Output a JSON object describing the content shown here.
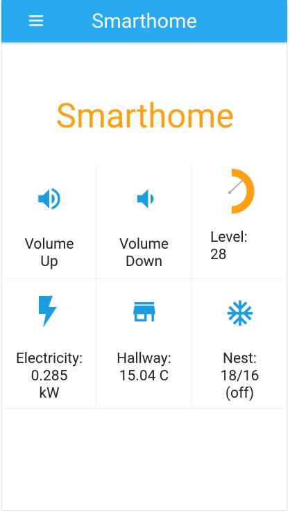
{
  "appbar": {
    "title": "Smarthome",
    "menu_icon": "hamburger-menu-icon",
    "background": "#29aaf0"
  },
  "hero": {
    "title": "Smarthome",
    "color": "#ffa010"
  },
  "tiles": [
    {
      "icon": "volume-up-icon",
      "lines": [
        "Volume",
        "Up"
      ]
    },
    {
      "icon": "volume-down-icon",
      "lines": [
        "Volume",
        "Down"
      ]
    },
    {
      "icon": "gauge-icon",
      "lines": [
        "Level:",
        "28"
      ]
    },
    {
      "icon": "lightning-bolt-icon",
      "lines": [
        "Electricity:",
        "0.285",
        "kW"
      ]
    },
    {
      "icon": "store-icon",
      "lines": [
        "Hallway:",
        "15.04 C"
      ]
    },
    {
      "icon": "snowflake-icon",
      "lines": [
        "Nest:",
        "18/16",
        "(off)"
      ]
    }
  ],
  "colors": {
    "icon_blue": "#1a9ee0",
    "gauge_orange": "#ffa010",
    "gauge_needle": "#b0b0b0"
  }
}
